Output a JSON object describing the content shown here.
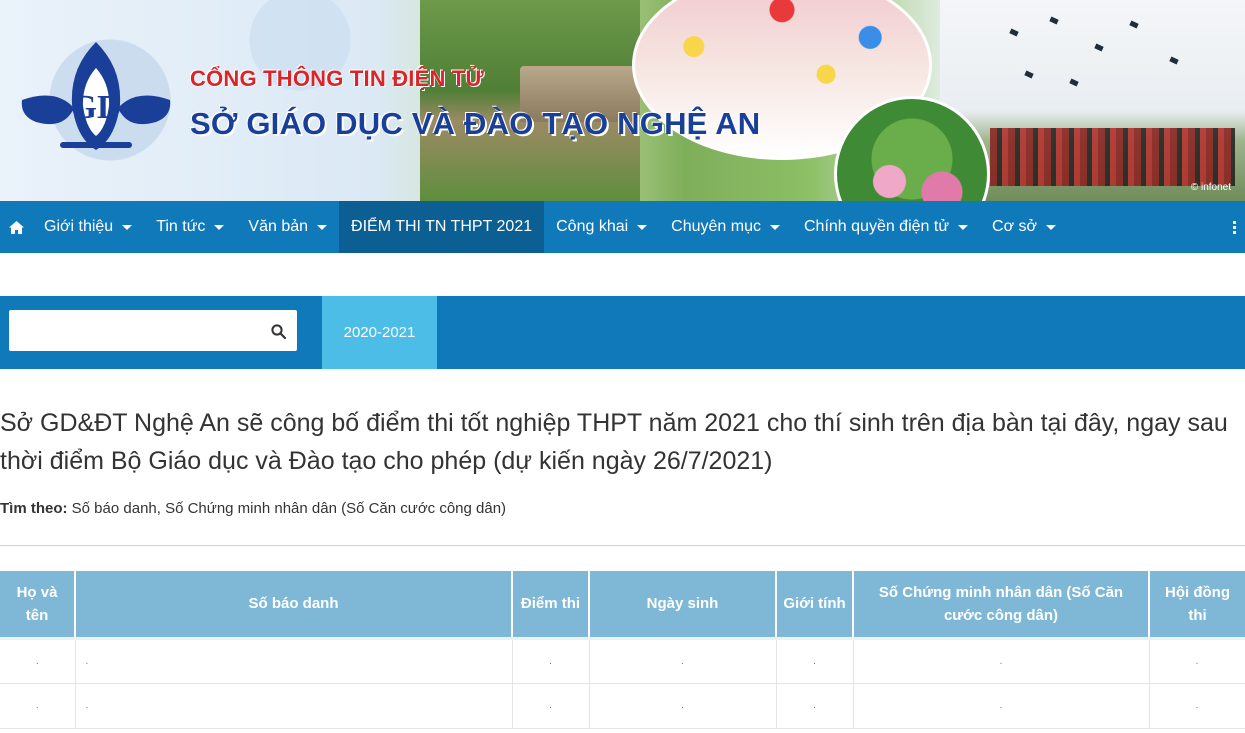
{
  "banner": {
    "portal_label": "CỔNG THÔNG TIN ĐIỆN TỬ",
    "department_name": "SỞ GIÁO DỤC VÀ ĐÀO TẠO NGHỆ AN",
    "watermark": "© infonet",
    "brand_red": "#d9242a",
    "brand_blue": "#1a3f99"
  },
  "nav": {
    "home_icon": "home-icon",
    "items": [
      {
        "label": "Giới thiệu",
        "dropdown": true
      },
      {
        "label": "Tin tức",
        "dropdown": true
      },
      {
        "label": "Văn bản",
        "dropdown": true
      },
      {
        "label": "ĐIỂM THI TN THPT 2021",
        "dropdown": false,
        "active": true
      },
      {
        "label": "Công khai",
        "dropdown": true
      },
      {
        "label": "Chuyên mục",
        "dropdown": true
      },
      {
        "label": "Chính quyền điện tử",
        "dropdown": true
      },
      {
        "label": "Cơ sở",
        "dropdown": true
      }
    ],
    "more_icon": "vertical-dots-icon",
    "bar_color": "#0f79ba"
  },
  "search": {
    "value": "",
    "placeholder": "",
    "icon": "search-icon",
    "year_tab": "2020-2021"
  },
  "content": {
    "headline": "Sở GD&ĐT Nghệ An sẽ công bố điểm thi tốt nghiệp THPT năm 2021 cho thí sinh trên địa bàn tại đây, ngay sau thời điểm Bộ Giáo dục và Đào tạo cho phép (dự kiến ngày 26/7/2021)",
    "search_by_label": "Tìm theo:",
    "search_by_value": "Số báo danh, Số Chứng minh nhân dân (Số Căn cước công dân)"
  },
  "table": {
    "columns": [
      "Họ và tên",
      "Số báo danh",
      "Điểm thi",
      "Ngày sinh",
      "Giới tính",
      "Số Chứng minh nhân dân (Số Căn cước công dân)",
      "Hội đồng thi"
    ],
    "rows": [
      [
        ".",
        ".",
        ".",
        ".",
        ".",
        ".",
        "."
      ],
      [
        ".",
        ".",
        ".",
        ".",
        ".",
        ".",
        "."
      ]
    ],
    "header_color": "#7fb8d6"
  }
}
